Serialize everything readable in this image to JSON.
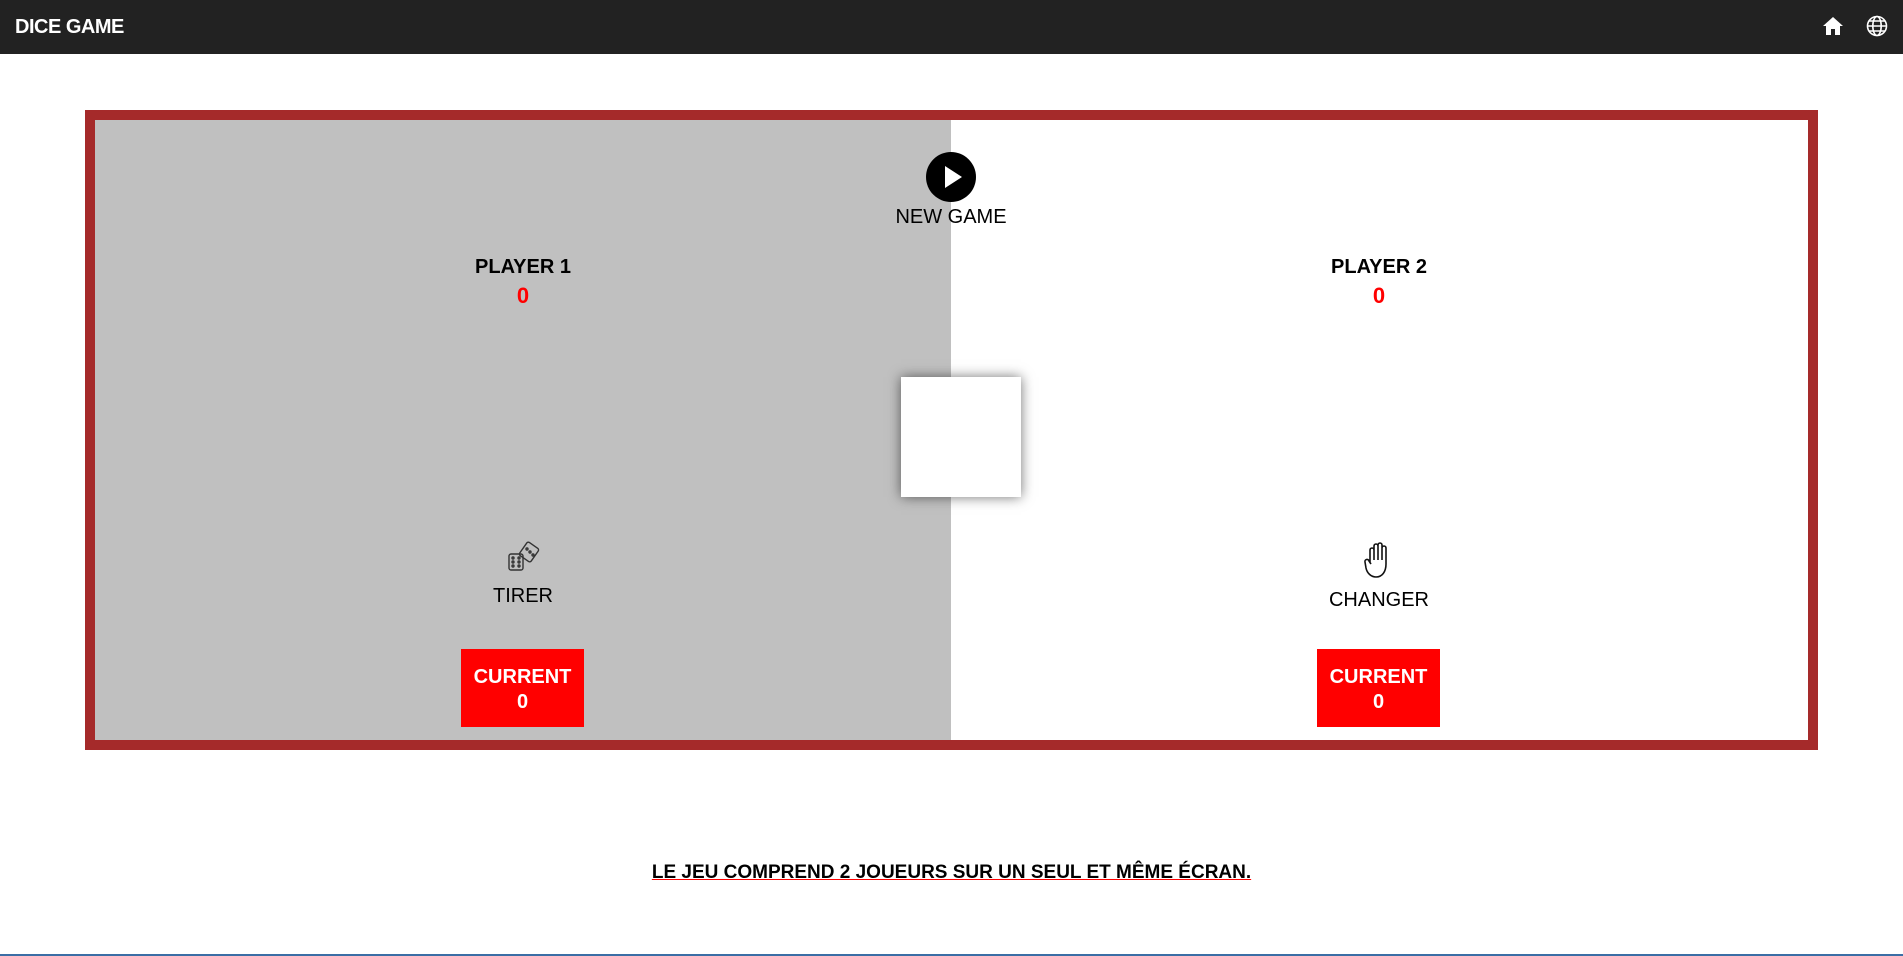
{
  "navbar": {
    "brand": "DICE GAME",
    "icons": [
      "home-icon",
      "globe-icon"
    ]
  },
  "game": {
    "new_game_label": "NEW GAME",
    "player1": {
      "name": "PLAYER 1",
      "score": "0",
      "action_label": "TIRER",
      "action_icon": "dice-icon",
      "current_label": "CURRENT",
      "current_value": "0"
    },
    "player2": {
      "name": "PLAYER 2",
      "score": "0",
      "action_label": "CHANGER",
      "action_icon": "hand-icon",
      "current_label": "CURRENT",
      "current_value": "0"
    }
  },
  "footer": {
    "text": "LE JEU COMPREND 2 JOUEURS SUR UN SEUL ET MÊME ÉCRAN."
  },
  "colors": {
    "navbar": "#222222",
    "board_border": "#a52a2a",
    "active_panel": "#c0c0c0",
    "accent_red": "#ff0000"
  }
}
